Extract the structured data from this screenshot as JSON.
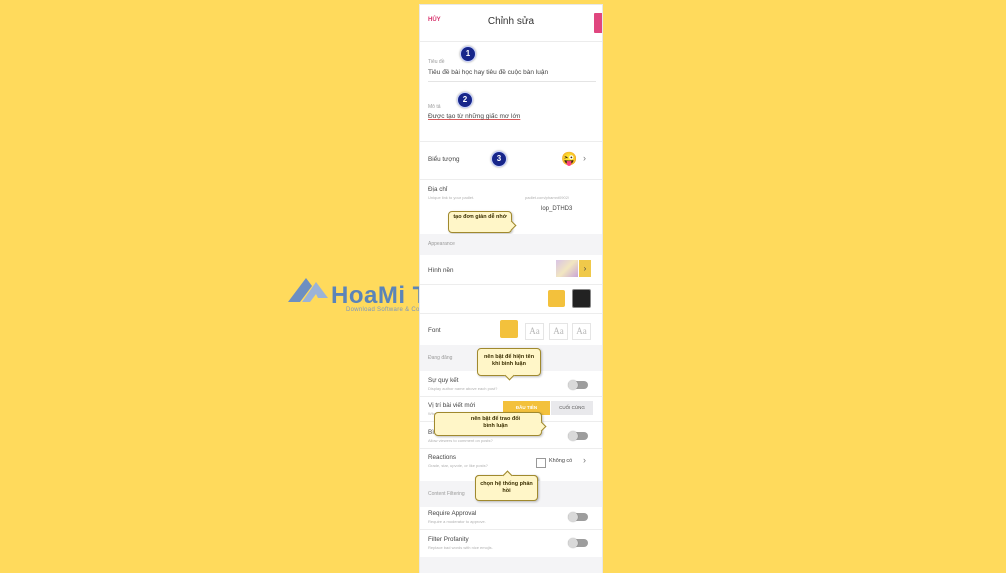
{
  "header": {
    "cancel_label": "HỦY",
    "title": "Chỉnh sửa"
  },
  "fields": {
    "title_label": "Tiêu đề",
    "title_value": "Tiêu đề bài học hay tiêu đề cuộc bàn luận",
    "desc_label": "Mô tả",
    "desc_value": "Được tạo từ những giấc mơ lớn",
    "icon_label": "Biểu tượng",
    "icon_emoji": "😜",
    "address_label": "Địa chỉ",
    "address_sub": "Unique link to your padlet.",
    "address_url": "padlet.com/phamnt0902/",
    "address_slug": "lop_DTHD3"
  },
  "appearance": {
    "section_label": "Appearance",
    "wallpaper_label": "Hình nền",
    "font_label": "Font",
    "font_options": [
      "Aa",
      "Aa",
      "Aa"
    ]
  },
  "engagement": {
    "section_label": "Đang đăng",
    "attribution_label": "Sự quy kết",
    "attribution_sub": "Display author name above each post?",
    "new_post_label": "Vị trí bài viết mới",
    "new_post_sub": "Where do new posts go?",
    "new_post_options": [
      "ĐẦU TIÊN",
      "CUỐI CÙNG"
    ],
    "comments_label": "Bình luận",
    "comments_sub": "Allow viewers to comment on posts?",
    "reactions_label": "Reactions",
    "reactions_sub": "Grade, star, upvote, or like posts?",
    "reactions_value": "Không có"
  },
  "filtering": {
    "section_label": "Content Filtering",
    "approval_label": "Require Approval",
    "approval_sub": "Require a moderator to approve.",
    "profanity_label": "Filter Profanity",
    "profanity_sub": "Replace bad words with nice emojis."
  },
  "annotations": {
    "badge1": "1",
    "badge2": "2",
    "badge3": "3",
    "callout_address": "tạo đơn giản dễ nhớ",
    "callout_attribution": "nên bật để hiện tên khi bình luận",
    "callout_comments": "nên bật  để trao đổi bình luận",
    "callout_reactions": "chọn hệ thống phản hồi"
  },
  "watermark": {
    "brand": "HoaMi Tech",
    "tagline": "Download Software & Computer Tips"
  },
  "colors": {
    "background": "#ffda5c",
    "accent": "#e0467f",
    "badge": "#17268a"
  }
}
